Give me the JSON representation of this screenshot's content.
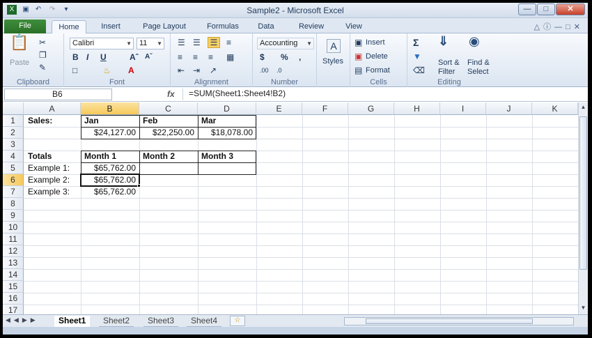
{
  "titlebar": {
    "title": "Sample2 - Microsoft Excel"
  },
  "tabs": [
    "File",
    "Home",
    "Insert",
    "Page Layout",
    "Formulas",
    "Data",
    "Review",
    "View"
  ],
  "ribbon": {
    "clipboard": {
      "paste": "Paste",
      "label": "Clipboard"
    },
    "font": {
      "name": "Calibri",
      "size": "11",
      "label": "Font"
    },
    "alignment": {
      "label": "Alignment"
    },
    "number": {
      "format": "Accounting",
      "label": "Number"
    },
    "styles": {
      "label": "Styles"
    },
    "cells": {
      "insert": "Insert",
      "delete": "Delete",
      "format": "Format",
      "label": "Cells"
    },
    "editing": {
      "sort": "Sort &",
      "filter": "Filter",
      "find": "Find &",
      "select": "Select",
      "label": "Editing"
    }
  },
  "formula_bar": {
    "name_box": "B6",
    "fx": "fx",
    "formula": "=SUM(Sheet1:Sheet4!B2)"
  },
  "columns": [
    "A",
    "B",
    "C",
    "D",
    "E",
    "F",
    "G",
    "H",
    "I",
    "J",
    "K"
  ],
  "rows": [
    "1",
    "2",
    "3",
    "4",
    "5",
    "6",
    "7",
    "8",
    "9",
    "10",
    "11",
    "12",
    "13",
    "14",
    "15",
    "16",
    "17"
  ],
  "cells": {
    "A1": "Sales:",
    "B1": "Jan",
    "C1": "Feb",
    "D1": "Mar",
    "B2": "$24,127.00",
    "C2": "$22,250.00",
    "D2": "$18,078.00",
    "A4": "Totals",
    "B4": "Month 1",
    "C4": "Month 2",
    "D4": "Month 3",
    "A5": "Example 1:",
    "B5": "$65,762.00",
    "A6": "Example 2:",
    "B6": "$65,762.00",
    "A7": "Example 3:",
    "B7": "$65,762.00"
  },
  "sheets": [
    "Sheet1",
    "Sheet2",
    "Sheet3",
    "Sheet4"
  ]
}
